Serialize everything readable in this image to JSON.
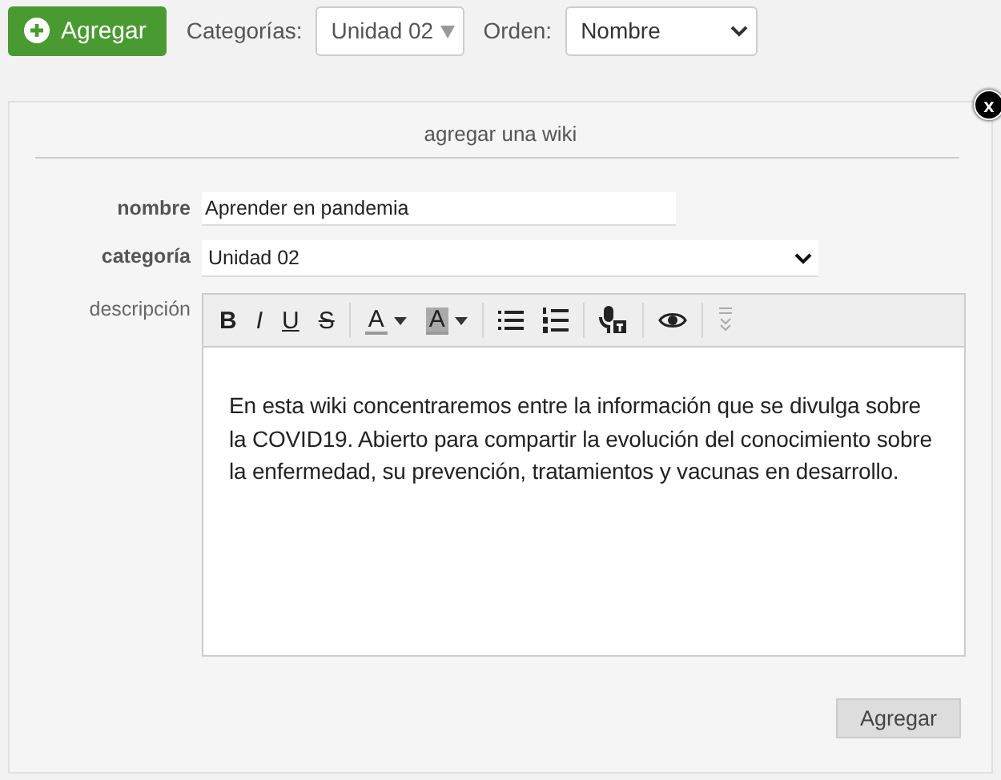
{
  "topbar": {
    "add_button": "Agregar",
    "categories_label": "Categorías:",
    "categories_value": "Unidad 02",
    "order_label": "Orden:",
    "order_value": "Nombre"
  },
  "dialog": {
    "title": "agregar una wiki",
    "close": "x",
    "fields": [
      {
        "label": "nombre",
        "kind": "text",
        "value": "Aprender en pandemia"
      },
      {
        "label": "categoría",
        "kind": "select",
        "value": "Unidad 02"
      },
      {
        "label": "descripción",
        "kind": "editor"
      }
    ],
    "toolbar": [
      {
        "kind": "bold",
        "label": "B"
      },
      {
        "kind": "italic",
        "label": "I"
      },
      {
        "kind": "underline",
        "label": "U"
      },
      {
        "kind": "strike",
        "label": "S"
      },
      {
        "kind": "sep"
      },
      {
        "kind": "color",
        "label": "A"
      },
      {
        "kind": "bgcolor",
        "label": "A"
      },
      {
        "kind": "sep"
      },
      {
        "kind": "ul"
      },
      {
        "kind": "ol"
      },
      {
        "kind": "sep"
      },
      {
        "kind": "speech"
      },
      {
        "kind": "sep"
      },
      {
        "kind": "preview"
      },
      {
        "kind": "sep"
      },
      {
        "kind": "more"
      }
    ],
    "description": "En esta wiki concentraremos entre la información que se divulga sobre la COVID19. Abierto para compartir la evolución del conocimiento sobre la enfermedad, su prevención, tratamientos y vacunas en desarrollo.",
    "submit": "Agregar"
  }
}
